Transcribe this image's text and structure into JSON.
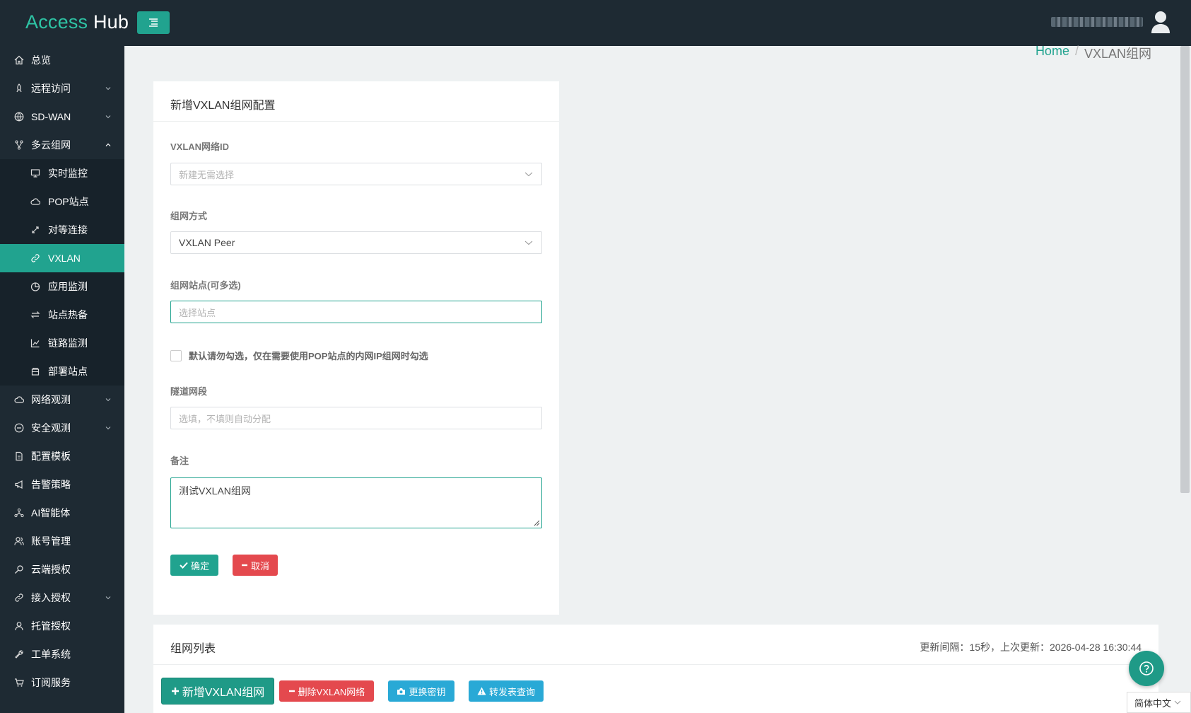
{
  "app": {
    "brand_main": "Access",
    "brand_hub": "Hub"
  },
  "colors": {
    "accent": "#21a38f",
    "danger": "#e4494e",
    "info": "#29a9d6",
    "sidebar_bg": "#1e2a33"
  },
  "sidebar": {
    "items": [
      {
        "label": "总览",
        "icon": "home-icon"
      },
      {
        "label": "远程访问",
        "icon": "rocket-icon",
        "expandable": true
      },
      {
        "label": "SD-WAN",
        "icon": "globe-icon",
        "expandable": true
      },
      {
        "label": "多云组网",
        "icon": "branch-icon",
        "expandable": true,
        "expanded": true
      },
      {
        "label": "实时监控",
        "icon": "monitor-icon",
        "sub": true
      },
      {
        "label": "POP站点",
        "icon": "cloud-icon",
        "sub": true
      },
      {
        "label": "对等连接",
        "icon": "diagonal-arrows-icon",
        "sub": true
      },
      {
        "label": "VXLAN",
        "icon": "link-icon",
        "sub": true,
        "active": true
      },
      {
        "label": "应用监测",
        "icon": "pie-icon",
        "sub": true
      },
      {
        "label": "站点热备",
        "icon": "swap-icon",
        "sub": true
      },
      {
        "label": "链路监测",
        "icon": "line-chart-icon",
        "sub": true
      },
      {
        "label": "部署站点",
        "icon": "box-icon",
        "sub": true
      },
      {
        "label": "网络观测",
        "icon": "cloud-icon",
        "expandable": true
      },
      {
        "label": "安全观测",
        "icon": "minus-circle-icon",
        "expandable": true
      },
      {
        "label": "配置模板",
        "icon": "file-icon"
      },
      {
        "label": "告警策略",
        "icon": "megaphone-icon"
      },
      {
        "label": "AI智能体",
        "icon": "network-icon"
      },
      {
        "label": "账号管理",
        "icon": "users-icon"
      },
      {
        "label": "云端授权",
        "icon": "key-icon"
      },
      {
        "label": "接入授权",
        "icon": "link-icon",
        "expandable": true
      },
      {
        "label": "托管授权",
        "icon": "user-icon"
      },
      {
        "label": "工单系统",
        "icon": "wrench-icon"
      },
      {
        "label": "订阅服务",
        "icon": "cart-icon"
      }
    ]
  },
  "breadcrumb": {
    "home": "Home",
    "sep": "/",
    "current": "VXLAN组网"
  },
  "form": {
    "title": "新增VXLAN组网配置",
    "vxlan_id_label": "VXLAN网络ID",
    "vxlan_id_placeholder": "新建无需选择",
    "mode_label": "组网方式",
    "mode_value": "VXLAN Peer",
    "sites_label": "组网站点(可多选)",
    "sites_placeholder": "选择站点",
    "checkbox_label": "默认请勿勾选，仅在需要使用POP站点的内网IP组网时勾选",
    "tunnel_label": "隧道网段",
    "tunnel_placeholder": "选填，不填则自动分配",
    "remark_label": "备注",
    "remark_value": "测试VXLAN组网",
    "ok_label": "确定",
    "cancel_label": "取消"
  },
  "list": {
    "title": "组网列表",
    "update_info": "更新间隔：15秒，上次更新：2026-04-28 16:30:44",
    "add_label": "新增VXLAN组网",
    "delete_label": "删除VXLAN网络",
    "rekey_label": "更换密钥",
    "forward_label": "转发表查询"
  },
  "lang": {
    "label": "简体中文"
  }
}
